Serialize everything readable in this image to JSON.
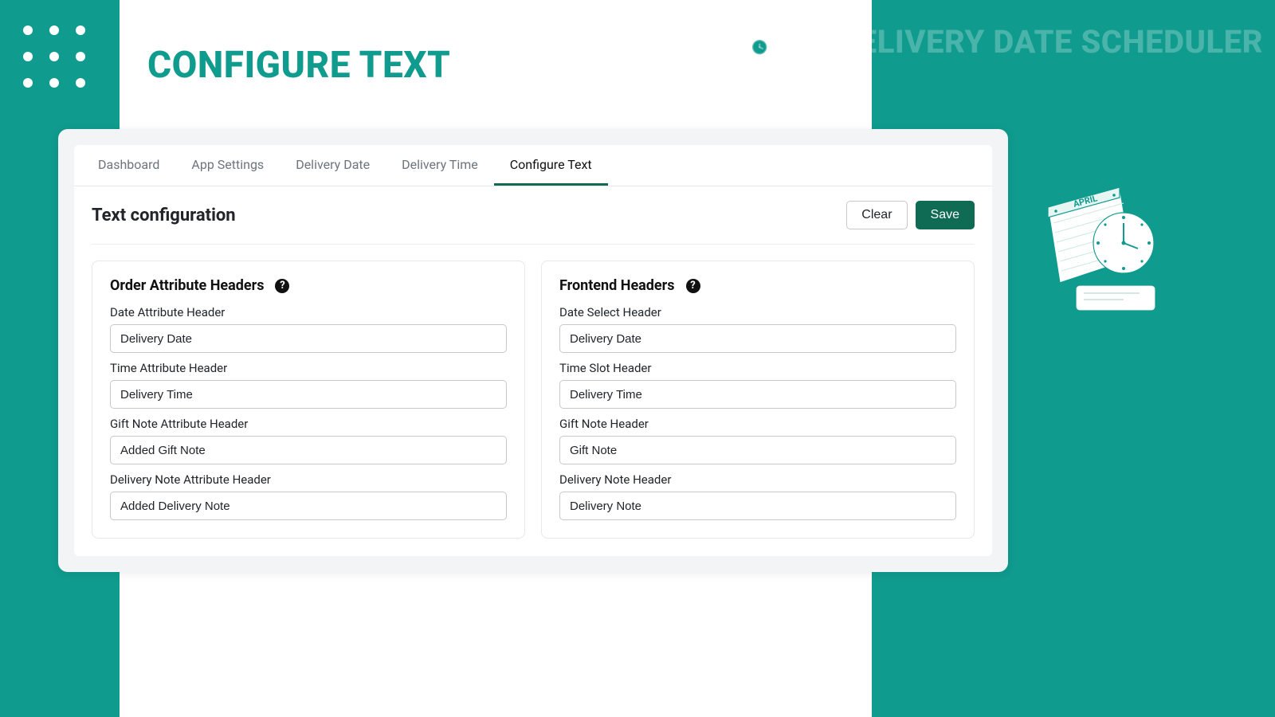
{
  "page": {
    "title": "CONFIGURE TEXT",
    "brand": "EM DELIVERY DATE SCHEDULER"
  },
  "tabs": [
    {
      "label": "Dashboard"
    },
    {
      "label": "App Settings"
    },
    {
      "label": "Delivery Date"
    },
    {
      "label": "Delivery Time"
    },
    {
      "label": "Configure Text",
      "active": true
    }
  ],
  "panel": {
    "title": "Text configuration",
    "clear_label": "Clear",
    "save_label": "Save"
  },
  "order_attr": {
    "title": "Order Attribute Headers",
    "date_label": "Date Attribute Header",
    "date_value": "Delivery Date",
    "time_label": "Time Attribute Header",
    "time_value": "Delivery Time",
    "gift_label": "Gift Note Attribute Header",
    "gift_value": "Added Gift Note",
    "delivery_note_label": "Delivery Note Attribute Header",
    "delivery_note_value": "Added Delivery Note"
  },
  "frontend": {
    "title": "Frontend Headers",
    "date_label": "Date Select Header",
    "date_value": "Delivery Date",
    "time_label": "Time Slot Header",
    "time_value": "Delivery Time",
    "gift_label": "Gift Note Header",
    "gift_value": "Gift Note",
    "delivery_note_label": "Delivery Note Header",
    "delivery_note_value": "Delivery Note"
  }
}
